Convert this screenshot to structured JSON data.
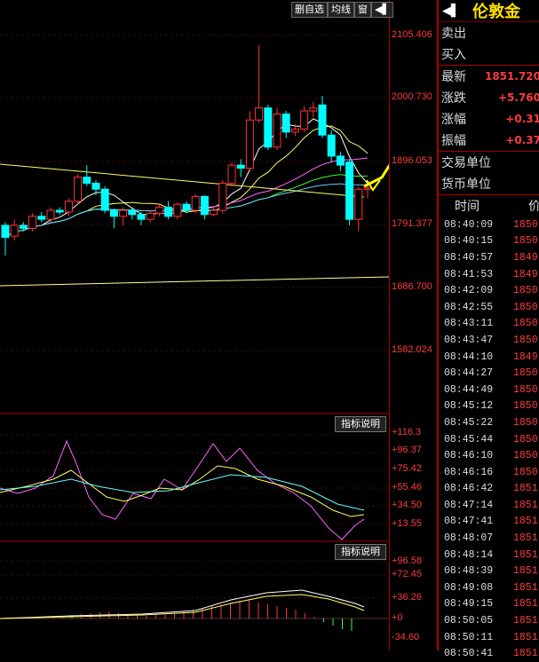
{
  "toolbar": {
    "b1": "删自选",
    "b2": "均线",
    "b3": "窗",
    "b4": "◀▌"
  },
  "price_axis": [
    "2105.406",
    "2000.730",
    "1896.053",
    "1791.377",
    "1686.700",
    "1582.024"
  ],
  "ind1": {
    "button": "指标说明",
    "labels": [
      "+116.3",
      "+96.37",
      "+75.42",
      "+55.46",
      "+34.50",
      "+13.55"
    ]
  },
  "ind2": {
    "button": "指标说明",
    "labels": [
      "+96.58",
      "+72.45",
      "+36.26",
      "+0",
      "-34.60"
    ]
  },
  "panel": {
    "icon": "◀▌",
    "title": "伦敦金",
    "sell": "卖出",
    "buy": "买入",
    "latest_label": "最新",
    "latest_value": "1851.720",
    "change_label": "涨跌",
    "change_value": "+5.760",
    "pct_label": "涨幅",
    "pct_value": "+0.31",
    "amp_label": "振幅",
    "amp_value": "+0.37",
    "unit_label": "交易单位",
    "currency_label": "货币单位",
    "time_header": "时间",
    "price_header": "价"
  },
  "ticks": [
    {
      "t": "08:40:09",
      "p": "1850"
    },
    {
      "t": "08:40:15",
      "p": "1850"
    },
    {
      "t": "08:40:57",
      "p": "1849"
    },
    {
      "t": "08:41:53",
      "p": "1849"
    },
    {
      "t": "08:42:09",
      "p": "1850"
    },
    {
      "t": "08:42:55",
      "p": "1850"
    },
    {
      "t": "08:43:11",
      "p": "1850"
    },
    {
      "t": "08:43:47",
      "p": "1850"
    },
    {
      "t": "08:44:10",
      "p": "1849"
    },
    {
      "t": "08:44:27",
      "p": "1850"
    },
    {
      "t": "08:44:49",
      "p": "1850"
    },
    {
      "t": "08:45:12",
      "p": "1850"
    },
    {
      "t": "08:45:22",
      "p": "1850"
    },
    {
      "t": "08:45:44",
      "p": "1850"
    },
    {
      "t": "08:46:10",
      "p": "1850"
    },
    {
      "t": "08:46:16",
      "p": "1850"
    },
    {
      "t": "08:46:42",
      "p": "1851"
    },
    {
      "t": "08:47:14",
      "p": "1851"
    },
    {
      "t": "08:47:41",
      "p": "1851"
    },
    {
      "t": "08:48:07",
      "p": "1851"
    },
    {
      "t": "08:48:14",
      "p": "1851"
    },
    {
      "t": "08:48:39",
      "p": "1851"
    },
    {
      "t": "08:49:08",
      "p": "1851"
    },
    {
      "t": "08:49:15",
      "p": "1851"
    },
    {
      "t": "08:50:05",
      "p": "1851"
    },
    {
      "t": "08:50:11",
      "p": "1851"
    },
    {
      "t": "08:50:41",
      "p": "1851"
    }
  ],
  "candles": [
    {
      "o": 1790,
      "c": 1770,
      "h": 1795,
      "l": 1740
    },
    {
      "o": 1772,
      "c": 1790,
      "h": 1800,
      "l": 1765
    },
    {
      "o": 1790,
      "c": 1785,
      "h": 1795,
      "l": 1780
    },
    {
      "o": 1785,
      "c": 1805,
      "h": 1810,
      "l": 1780
    },
    {
      "o": 1805,
      "c": 1800,
      "h": 1812,
      "l": 1795
    },
    {
      "o": 1800,
      "c": 1815,
      "h": 1820,
      "l": 1795
    },
    {
      "o": 1815,
      "c": 1812,
      "h": 1820,
      "l": 1808
    },
    {
      "o": 1812,
      "c": 1830,
      "h": 1835,
      "l": 1805
    },
    {
      "o": 1830,
      "c": 1870,
      "h": 1875,
      "l": 1825
    },
    {
      "o": 1870,
      "c": 1860,
      "h": 1890,
      "l": 1855
    },
    {
      "o": 1860,
      "c": 1850,
      "h": 1865,
      "l": 1840
    },
    {
      "o": 1850,
      "c": 1815,
      "h": 1855,
      "l": 1810
    },
    {
      "o": 1815,
      "c": 1805,
      "h": 1818,
      "l": 1785
    },
    {
      "o": 1805,
      "c": 1815,
      "h": 1820,
      "l": 1790
    },
    {
      "o": 1815,
      "c": 1808,
      "h": 1818,
      "l": 1800
    },
    {
      "o": 1808,
      "c": 1800,
      "h": 1812,
      "l": 1790
    },
    {
      "o": 1800,
      "c": 1810,
      "h": 1815,
      "l": 1795
    },
    {
      "o": 1810,
      "c": 1820,
      "h": 1825,
      "l": 1805
    },
    {
      "o": 1820,
      "c": 1805,
      "h": 1830,
      "l": 1800
    },
    {
      "o": 1805,
      "c": 1825,
      "h": 1828,
      "l": 1800
    },
    {
      "o": 1825,
      "c": 1815,
      "h": 1830,
      "l": 1810
    },
    {
      "o": 1815,
      "c": 1838,
      "h": 1842,
      "l": 1810
    },
    {
      "o": 1838,
      "c": 1808,
      "h": 1840,
      "l": 1800
    },
    {
      "o": 1808,
      "c": 1815,
      "h": 1822,
      "l": 1805
    },
    {
      "o": 1815,
      "c": 1860,
      "h": 1865,
      "l": 1810
    },
    {
      "o": 1860,
      "c": 1890,
      "h": 1895,
      "l": 1855
    },
    {
      "o": 1890,
      "c": 1885,
      "h": 1900,
      "l": 1870
    },
    {
      "o": 1885,
      "c": 1965,
      "h": 1980,
      "l": 1880
    },
    {
      "o": 1965,
      "c": 1985,
      "h": 2090,
      "l": 1960
    },
    {
      "o": 1985,
      "c": 1920,
      "h": 1990,
      "l": 1915
    },
    {
      "o": 1920,
      "c": 1975,
      "h": 1985,
      "l": 1915
    },
    {
      "o": 1975,
      "c": 1945,
      "h": 1980,
      "l": 1935
    },
    {
      "o": 1945,
      "c": 1950,
      "h": 1958,
      "l": 1938
    },
    {
      "o": 1950,
      "c": 1980,
      "h": 1988,
      "l": 1945
    },
    {
      "o": 1980,
      "c": 1985,
      "h": 1995,
      "l": 1970
    },
    {
      "o": 1990,
      "c": 1940,
      "h": 2005,
      "l": 1935
    },
    {
      "o": 1940,
      "c": 1905,
      "h": 1948,
      "l": 1895
    },
    {
      "o": 1905,
      "c": 1890,
      "h": 1912,
      "l": 1880
    },
    {
      "o": 1895,
      "c": 1800,
      "h": 1900,
      "l": 1790
    },
    {
      "o": 1800,
      "c": 1850,
      "h": 1855,
      "l": 1780
    },
    {
      "o": 1850,
      "c": 1852,
      "h": 1860,
      "l": 1835
    }
  ]
}
